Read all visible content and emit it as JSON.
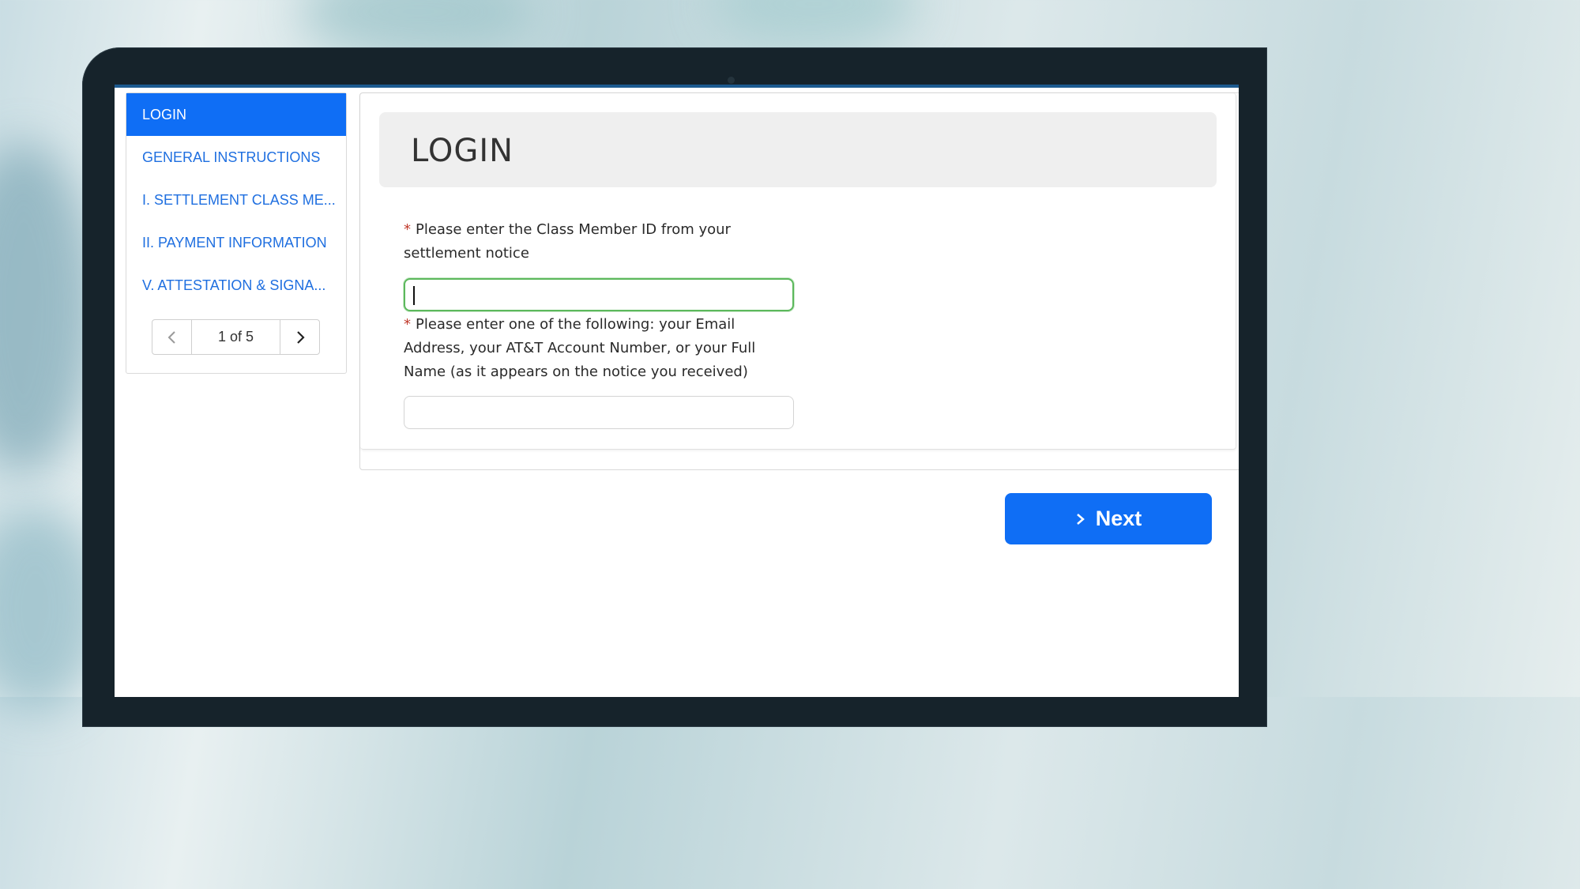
{
  "sidebar": {
    "items": [
      {
        "label": "LOGIN",
        "active": true
      },
      {
        "label": "GENERAL INSTRUCTIONS",
        "active": false
      },
      {
        "label": "I. SETTLEMENT CLASS ME...",
        "active": false
      },
      {
        "label": "II. PAYMENT INFORMATION",
        "active": false
      },
      {
        "label": "V. ATTESTATION & SIGNA...",
        "active": false
      }
    ],
    "pager": {
      "text": "1 of 5"
    }
  },
  "main": {
    "title": "LOGIN",
    "fields": [
      {
        "required_mark": "*",
        "label": "Please enter the Class Member ID from your settlement notice",
        "value": ""
      },
      {
        "required_mark": "*",
        "label": "Please enter one of the following: your Email Address, your AT&T Account Number, or your Full Name (as it appears on the notice you received)",
        "value": ""
      }
    ]
  },
  "actions": {
    "next_label": "Next"
  },
  "colors": {
    "primary": "#0f6ef5",
    "link": "#1f6fe0",
    "required": "#c0392b",
    "focus_border": "#5cb85c"
  }
}
